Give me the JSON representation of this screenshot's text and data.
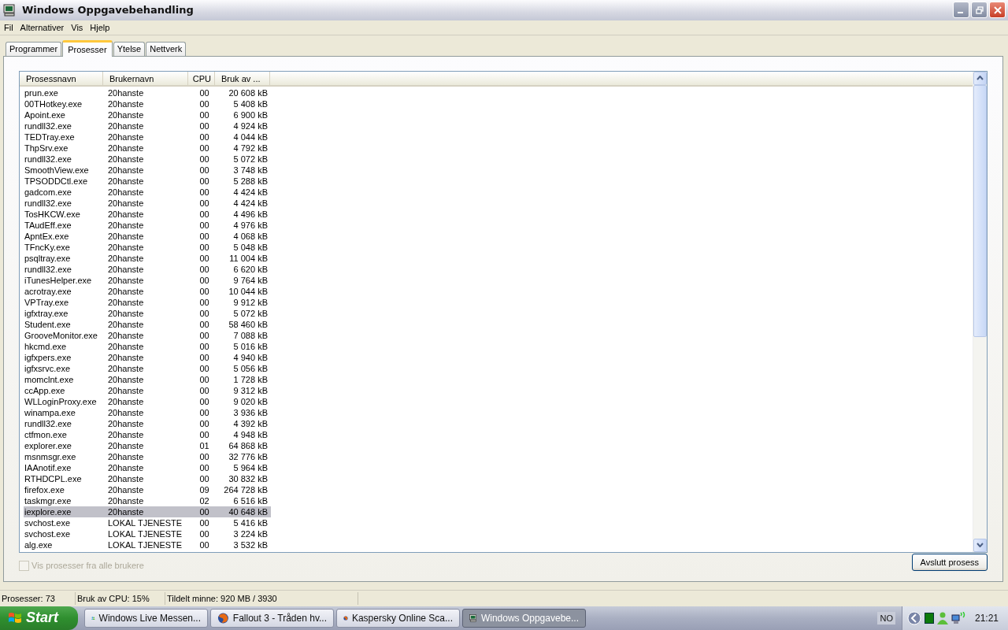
{
  "window": {
    "title": "Windows Oppgavebehandling"
  },
  "menu": [
    "Fil",
    "Alternativer",
    "Vis",
    "Hjelp"
  ],
  "tabs": [
    {
      "label": "Programmer",
      "selected": false
    },
    {
      "label": "Prosesser",
      "selected": true
    },
    {
      "label": "Ytelse",
      "selected": false
    },
    {
      "label": "Nettverk",
      "selected": false
    }
  ],
  "table": {
    "columns": [
      "Prosessnavn",
      "Brukernavn",
      "CPU",
      "Bruk av ..."
    ],
    "rows": [
      {
        "cells": [
          "prun.exe",
          "20hanste",
          "00",
          "20 608 kB"
        ],
        "selected": false
      },
      {
        "cells": [
          "00THotkey.exe",
          "20hanste",
          "00",
          "5 408 kB"
        ],
        "selected": false
      },
      {
        "cells": [
          "Apoint.exe",
          "20hanste",
          "00",
          "6 900 kB"
        ],
        "selected": false
      },
      {
        "cells": [
          "rundll32.exe",
          "20hanste",
          "00",
          "4 924 kB"
        ],
        "selected": false
      },
      {
        "cells": [
          "TEDTray.exe",
          "20hanste",
          "00",
          "4 044 kB"
        ],
        "selected": false
      },
      {
        "cells": [
          "ThpSrv.exe",
          "20hanste",
          "00",
          "4 792 kB"
        ],
        "selected": false
      },
      {
        "cells": [
          "rundll32.exe",
          "20hanste",
          "00",
          "5 072 kB"
        ],
        "selected": false
      },
      {
        "cells": [
          "SmoothView.exe",
          "20hanste",
          "00",
          "3 748 kB"
        ],
        "selected": false
      },
      {
        "cells": [
          "TPSODDCtl.exe",
          "20hanste",
          "00",
          "5 288 kB"
        ],
        "selected": false
      },
      {
        "cells": [
          "gadcom.exe",
          "20hanste",
          "00",
          "4 424 kB"
        ],
        "selected": false
      },
      {
        "cells": [
          "rundll32.exe",
          "20hanste",
          "00",
          "4 424 kB"
        ],
        "selected": false
      },
      {
        "cells": [
          "TosHKCW.exe",
          "20hanste",
          "00",
          "4 496 kB"
        ],
        "selected": false
      },
      {
        "cells": [
          "TAudEff.exe",
          "20hanste",
          "00",
          "4 976 kB"
        ],
        "selected": false
      },
      {
        "cells": [
          "ApntEx.exe",
          "20hanste",
          "00",
          "4 068 kB"
        ],
        "selected": false
      },
      {
        "cells": [
          "TFncKy.exe",
          "20hanste",
          "00",
          "5 048 kB"
        ],
        "selected": false
      },
      {
        "cells": [
          "psqltray.exe",
          "20hanste",
          "00",
          "11 004 kB"
        ],
        "selected": false
      },
      {
        "cells": [
          "rundll32.exe",
          "20hanste",
          "00",
          "6 620 kB"
        ],
        "selected": false
      },
      {
        "cells": [
          "iTunesHelper.exe",
          "20hanste",
          "00",
          "9 764 kB"
        ],
        "selected": false
      },
      {
        "cells": [
          "acrotray.exe",
          "20hanste",
          "00",
          "10 044 kB"
        ],
        "selected": false
      },
      {
        "cells": [
          "VPTray.exe",
          "20hanste",
          "00",
          "9 912 kB"
        ],
        "selected": false
      },
      {
        "cells": [
          "igfxtray.exe",
          "20hanste",
          "00",
          "5 072 kB"
        ],
        "selected": false
      },
      {
        "cells": [
          "Student.exe",
          "20hanste",
          "00",
          "58 460 kB"
        ],
        "selected": false
      },
      {
        "cells": [
          "GrooveMonitor.exe",
          "20hanste",
          "00",
          "7 088 kB"
        ],
        "selected": false
      },
      {
        "cells": [
          "hkcmd.exe",
          "20hanste",
          "00",
          "5 016 kB"
        ],
        "selected": false
      },
      {
        "cells": [
          "igfxpers.exe",
          "20hanste",
          "00",
          "4 940 kB"
        ],
        "selected": false
      },
      {
        "cells": [
          "igfxsrvc.exe",
          "20hanste",
          "00",
          "5 056 kB"
        ],
        "selected": false
      },
      {
        "cells": [
          "momclnt.exe",
          "20hanste",
          "00",
          "1 728 kB"
        ],
        "selected": false
      },
      {
        "cells": [
          "ccApp.exe",
          "20hanste",
          "00",
          "9 312 kB"
        ],
        "selected": false
      },
      {
        "cells": [
          "WLLoginProxy.exe",
          "20hanste",
          "00",
          "9 020 kB"
        ],
        "selected": false
      },
      {
        "cells": [
          "winampa.exe",
          "20hanste",
          "00",
          "3 936 kB"
        ],
        "selected": false
      },
      {
        "cells": [
          "rundll32.exe",
          "20hanste",
          "00",
          "4 392 kB"
        ],
        "selected": false
      },
      {
        "cells": [
          "ctfmon.exe",
          "20hanste",
          "00",
          "4 948 kB"
        ],
        "selected": false
      },
      {
        "cells": [
          "explorer.exe",
          "20hanste",
          "01",
          "64 868 kB"
        ],
        "selected": false
      },
      {
        "cells": [
          "msnmsgr.exe",
          "20hanste",
          "00",
          "32 776 kB"
        ],
        "selected": false
      },
      {
        "cells": [
          "IAAnotif.exe",
          "20hanste",
          "00",
          "5 964 kB"
        ],
        "selected": false
      },
      {
        "cells": [
          "RTHDCPL.exe",
          "20hanste",
          "00",
          "30 832 kB"
        ],
        "selected": false
      },
      {
        "cells": [
          "firefox.exe",
          "20hanste",
          "09",
          "264 728 kB"
        ],
        "selected": false
      },
      {
        "cells": [
          "taskmgr.exe",
          "20hanste",
          "02",
          "6 516 kB"
        ],
        "selected": false
      },
      {
        "cells": [
          "iexplore.exe",
          "20hanste",
          "00",
          "40 648 kB"
        ],
        "selected": true
      },
      {
        "cells": [
          "svchost.exe",
          "LOKAL TJENESTE",
          "00",
          "5 416 kB"
        ],
        "selected": false
      },
      {
        "cells": [
          "svchost.exe",
          "LOKAL TJENESTE",
          "00",
          "3 224 kB"
        ],
        "selected": false
      },
      {
        "cells": [
          "alg.exe",
          "LOKAL TJENESTE",
          "00",
          "3 532 kB"
        ],
        "selected": false
      }
    ]
  },
  "all_users_checkbox": {
    "label": "Vis prosesser fra alle brukere",
    "checked": false,
    "disabled": true
  },
  "end_process_button": "Avslutt prosess",
  "status_bar": [
    "Prosesser: 73",
    "Bruk av CPU: 15%",
    "Tildelt minne: 920 MB / 3930"
  ],
  "taskbar": {
    "start": "Start",
    "buttons": [
      {
        "label": "Windows Live Messen...",
        "kind": "people",
        "selected": false
      },
      {
        "label": "Fallout 3 - Tråden hv...",
        "kind": "globe",
        "selected": false
      },
      {
        "label": "Kaspersky Online Sca...",
        "kind": "globe",
        "selected": false
      },
      {
        "label": "Windows Oppgavebe...",
        "kind": "monitor",
        "selected": true
      }
    ],
    "language": "NO",
    "clock": "21:21"
  }
}
